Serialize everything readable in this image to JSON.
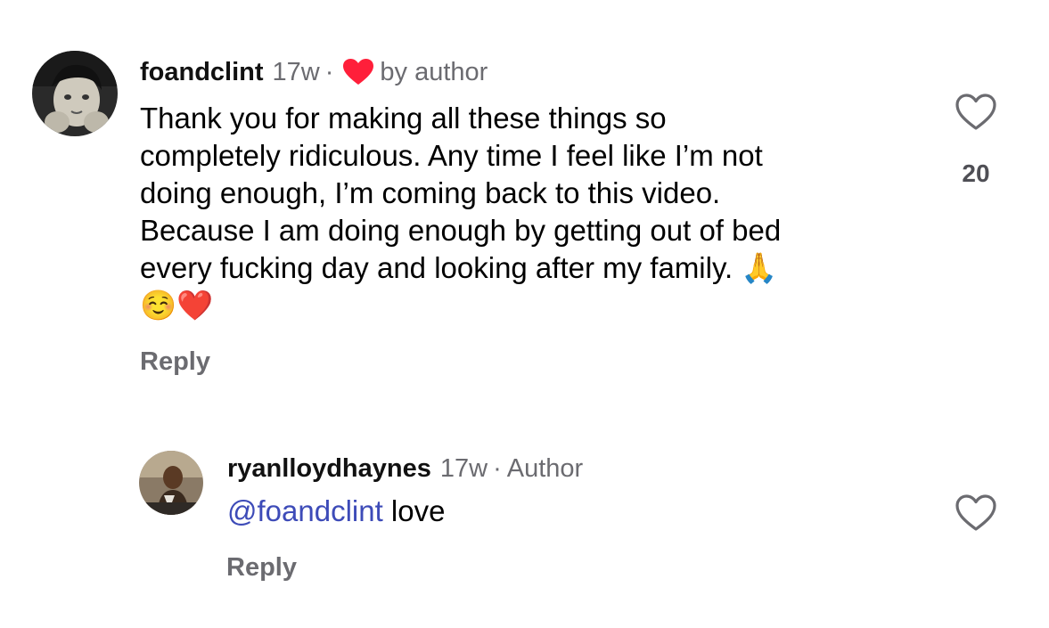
{
  "comment": {
    "username": "foandclint",
    "time": "17w",
    "separator": "·",
    "liked_by_label": "by author",
    "lines": [
      "Thank you for making all these things so",
      "completely ridiculous. Any time I feel like I’m not",
      "doing enough, I’m coming back to this video.",
      "Because I am doing enough by getting out of bed",
      "every fucking day and looking after my family."
    ],
    "emoji_pray": "🙏",
    "emoji_smile": "☺️",
    "emoji_heart": "❤️",
    "reply_label": "Reply",
    "like_count": "20"
  },
  "reply": {
    "username": "ryanlloydhaynes",
    "time": "17w",
    "separator": "·",
    "badge": "Author",
    "mention": "@foandclint",
    "text": " love",
    "reply_label": "Reply"
  },
  "colors": {
    "liked_heart": "#ff1f3a",
    "mention": "#3d4bb8",
    "muted": "#6b6b70"
  },
  "icons": {
    "liked_by_author": "heart-filled-icon",
    "like_button": "heart-outline-icon"
  }
}
